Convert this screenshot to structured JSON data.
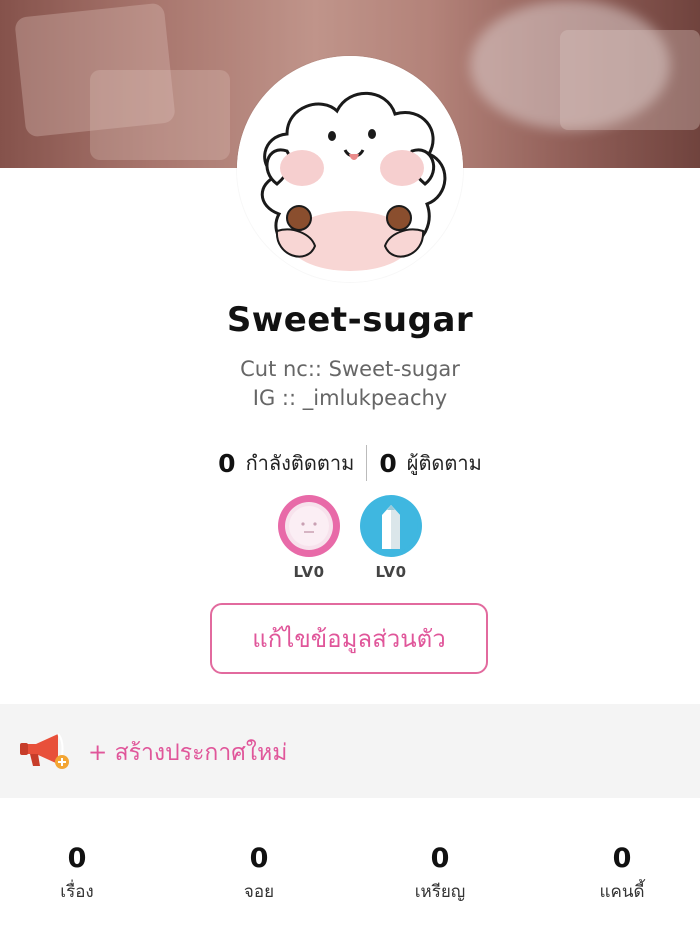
{
  "profile": {
    "name": "Sweet-sugar",
    "bio_line1": "Cut nc:: Sweet-sugar",
    "bio_line2": "IG :: _imlukpeachy"
  },
  "follow": {
    "following_count": "0",
    "following_label": "กำลังติดตาม",
    "followers_count": "0",
    "followers_label": "ผู้ติดตาม"
  },
  "badges": [
    {
      "icon": "writer-face-badge-icon",
      "level": "LV0",
      "color": "#e86aa8"
    },
    {
      "icon": "pencil-badge-icon",
      "level": "LV0",
      "color": "#3fb7e0"
    }
  ],
  "edit_profile_label": "แก้ไขข้อมูลส่วนตัว",
  "announcement": {
    "icon": "megaphone-icon",
    "label": "+ สร้างประกาศใหม่"
  },
  "stats": [
    {
      "value": "0",
      "label": "เรื่อง"
    },
    {
      "value": "0",
      "label": "จอย"
    },
    {
      "value": "0",
      "label": "เหรียญ"
    },
    {
      "value": "0",
      "label": "แคนดี้"
    }
  ],
  "colors": {
    "accent_pink": "#e0569a",
    "badge_blue": "#3fb7e0"
  }
}
